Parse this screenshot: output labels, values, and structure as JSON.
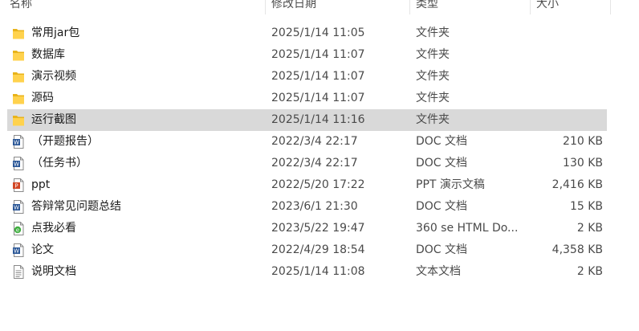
{
  "columns": {
    "name": "名称",
    "date": "修改日期",
    "type": "类型",
    "size": "大小"
  },
  "files": [
    {
      "name": "常用jar包",
      "date": "2025/1/14 11:05",
      "type": "文件夹",
      "size": "",
      "icon": "folder-icon",
      "selected": false
    },
    {
      "name": "数据库",
      "date": "2025/1/14 11:07",
      "type": "文件夹",
      "size": "",
      "icon": "folder-icon",
      "selected": false
    },
    {
      "name": "演示视频",
      "date": "2025/1/14 11:07",
      "type": "文件夹",
      "size": "",
      "icon": "folder-icon",
      "selected": false
    },
    {
      "name": "源码",
      "date": "2025/1/14 11:07",
      "type": "文件夹",
      "size": "",
      "icon": "folder-icon",
      "selected": false
    },
    {
      "name": "运行截图",
      "date": "2025/1/14 11:16",
      "type": "文件夹",
      "size": "",
      "icon": "folder-icon",
      "selected": true
    },
    {
      "name": "（开题报告）",
      "date": "2022/3/4 22:17",
      "type": "DOC 文档",
      "size": "210 KB",
      "icon": "word-doc-icon",
      "selected": false
    },
    {
      "name": "（任务书）",
      "date": "2022/3/4 22:17",
      "type": "DOC 文档",
      "size": "130 KB",
      "icon": "word-doc-icon",
      "selected": false
    },
    {
      "name": "ppt",
      "date": "2022/5/20 17:22",
      "type": "PPT 演示文稿",
      "size": "2,416 KB",
      "icon": "ppt-doc-icon",
      "selected": false
    },
    {
      "name": "答辩常见问题总结",
      "date": "2023/6/1 21:30",
      "type": "DOC 文档",
      "size": "15 KB",
      "icon": "word-doc-icon",
      "selected": false
    },
    {
      "name": "点我必看",
      "date": "2023/5/22 19:47",
      "type": "360 se HTML Do...",
      "size": "2 KB",
      "icon": "html-doc-icon",
      "selected": false
    },
    {
      "name": "论文",
      "date": "2022/4/29 18:54",
      "type": "DOC 文档",
      "size": "4,358 KB",
      "icon": "word-doc-icon",
      "selected": false
    },
    {
      "name": "说明文档",
      "date": "2025/1/14 11:08",
      "type": "文本文档",
      "size": "2 KB",
      "icon": "text-doc-icon",
      "selected": false
    }
  ]
}
